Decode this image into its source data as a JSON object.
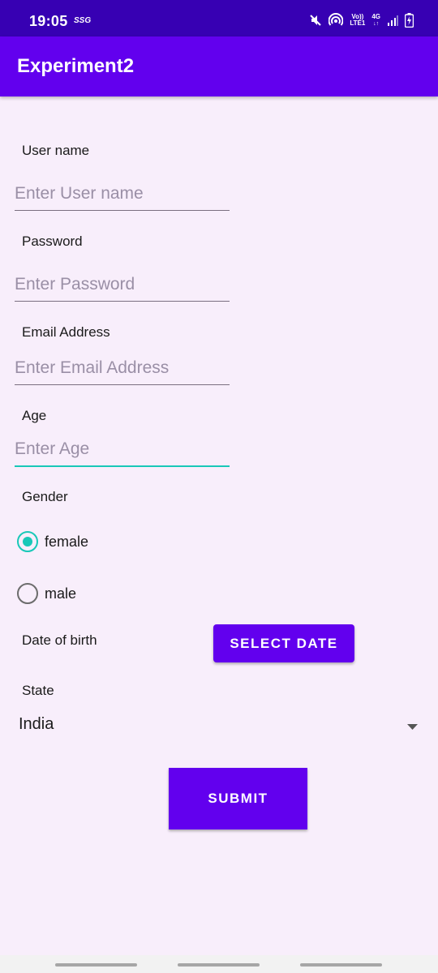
{
  "status_bar": {
    "time": "19:05",
    "carrier_badge": "SSG",
    "volte_top": "Vo))",
    "volte_bottom": "LTE1",
    "network": "4G",
    "icons": [
      "mute-icon",
      "hotspot-icon",
      "volte-icon",
      "network-4g-icon",
      "signal-icon",
      "battery-charging-icon"
    ]
  },
  "app_bar": {
    "title": "Experiment2"
  },
  "form": {
    "username": {
      "label": "User name",
      "placeholder": "Enter User name",
      "value": ""
    },
    "password": {
      "label": "Password",
      "placeholder": "Enter Password",
      "value": ""
    },
    "email": {
      "label": "Email Address",
      "placeholder": "Enter Email Address",
      "value": ""
    },
    "age": {
      "label": "Age",
      "placeholder": "Enter Age",
      "value": ""
    },
    "gender": {
      "label": "Gender",
      "options": [
        {
          "label": "female",
          "checked": true
        },
        {
          "label": "male",
          "checked": false
        }
      ]
    },
    "dob": {
      "label": "Date of birth",
      "button_label": "SELECT DATE"
    },
    "state": {
      "label": "State",
      "selected": "India"
    },
    "submit_label": "SUBMIT"
  },
  "colors": {
    "status_bar": "#3700b3",
    "primary": "#6200ee",
    "accent": "#19c8b8",
    "background": "#f8eefb"
  }
}
